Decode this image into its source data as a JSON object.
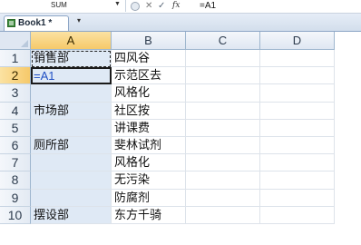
{
  "formula_bar": {
    "name_box": "SUM",
    "name_box_dropdown_icon": "chevron-down-icon",
    "buttons": {
      "circle": "circle-button-icon",
      "cancel": "✕",
      "enter": "✓",
      "insert_function": "fx"
    },
    "content": "=A1"
  },
  "workbook_tabs": [
    {
      "label": "Book1 *",
      "icon": "excel-workbook-icon"
    }
  ],
  "tab_dropdown_icon": "▾",
  "sheet": {
    "column_headers": [
      "A",
      "B",
      "C",
      "D"
    ],
    "rows": [
      {
        "num": "1",
        "A": "销售部",
        "B": "四风谷"
      },
      {
        "num": "2",
        "A": "=A1",
        "B": "示范区去"
      },
      {
        "num": "3",
        "A": "",
        "B": "风格化"
      },
      {
        "num": "4",
        "A": "市场部",
        "B": "社区按"
      },
      {
        "num": "5",
        "A": "",
        "B": "讲课费"
      },
      {
        "num": "6",
        "A": "厕所部",
        "B": "斐林试剂"
      },
      {
        "num": "7",
        "A": "",
        "B": "风格化"
      },
      {
        "num": "8",
        "A": "",
        "B": "无污染"
      },
      {
        "num": "9",
        "A": "",
        "B": "防腐剂"
      },
      {
        "num": "10",
        "A": "摆设部",
        "B": "东方千骑"
      }
    ]
  },
  "colors": {
    "selected_header": "#f6c96a",
    "column_a_selection": "#dfe9f5",
    "formula_text": "#1f4fc4"
  }
}
